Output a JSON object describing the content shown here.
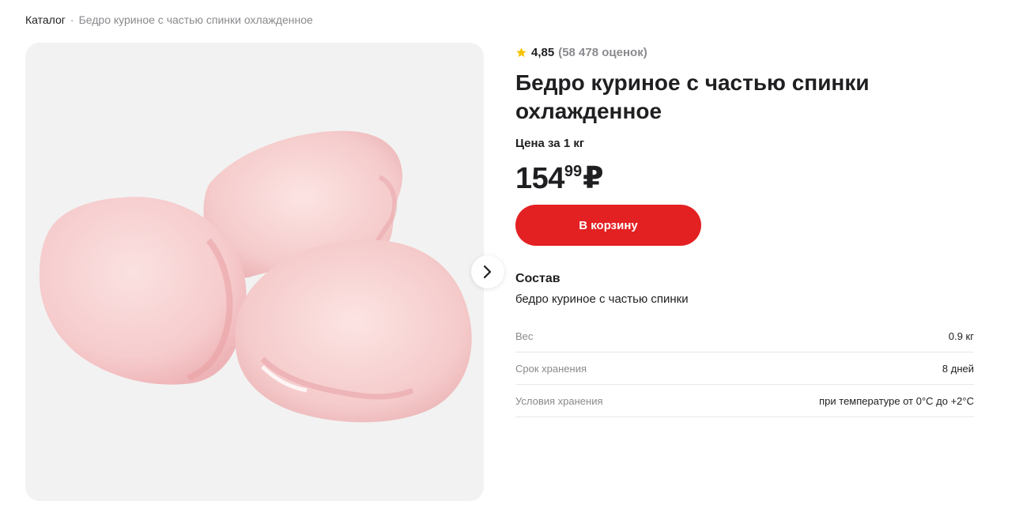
{
  "breadcrumb": {
    "catalog": "Каталог",
    "separator": "·",
    "current": "Бедро куриное с частью спинки охлажденное"
  },
  "gallery": {
    "image_icon": "chicken-thighs-photo",
    "next_icon": "chevron-right-icon"
  },
  "product": {
    "rating_icon": "star-icon",
    "rating_value": "4,85",
    "rating_count": "(58 478 оценок)",
    "title": "Бедро куриное с частью спинки охлажденное",
    "unit_label": "Цена за 1 кг",
    "price_rubles": "154",
    "price_kopecks": "99",
    "currency": "₽",
    "cart_button": "В корзину"
  },
  "composition": {
    "title": "Состав",
    "text": "бедро куриное с частью спинки"
  },
  "specs": [
    {
      "label": "Вес",
      "value": "0.9 кг"
    },
    {
      "label": "Срок хранения",
      "value": "8 дней"
    },
    {
      "label": "Условия хранения",
      "value": "при температуре от 0°C до +2°C"
    }
  ],
  "colors": {
    "accent": "#e32022",
    "star": "#f5c400",
    "muted": "#8a8a8e",
    "text": "#1f1f22"
  }
}
